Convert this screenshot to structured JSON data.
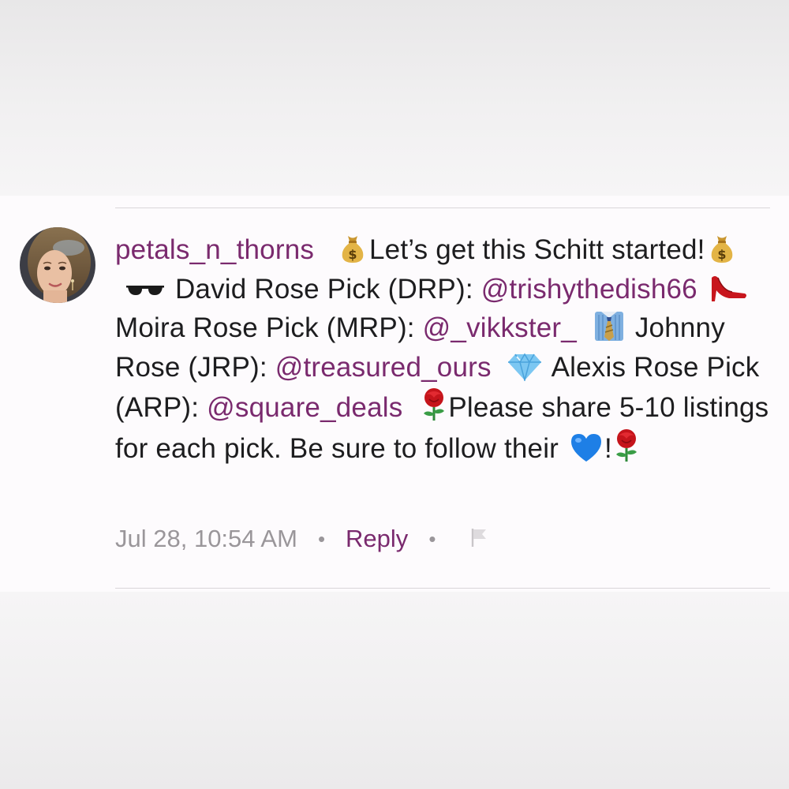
{
  "comment": {
    "username": "petals_n_thorns",
    "text": {
      "t1": "Let’s get this Schitt",
      "t2": "started!",
      "t3": "David Rose Pick (DRP):",
      "m1": "@trishythedish66",
      "t4": "Moira Rose Pick (MRP):",
      "m2": "@_vikkster_",
      "t5": "Johnny Rose (JRP):",
      "m3": "@treasured_ours",
      "t6": "Alexis Rose Pick (ARP):",
      "m4": "@square_deals",
      "t7": "Please share 5-10 listings for each pick. Be sure to follow their",
      "t8": "!"
    },
    "emojis": [
      "money-bag",
      "money-bag",
      "sunglasses",
      "high-heel",
      "necktie-shirt",
      "gem",
      "rose",
      "blue-heart",
      "rose"
    ]
  },
  "meta": {
    "timestamp": "Jul 28, 10:54 AM",
    "separator": "•",
    "reply_label": "Reply"
  },
  "colors": {
    "username": "#7a2a6e",
    "mention": "#7a2a6e",
    "body_text": "#1d1d1f",
    "meta_text": "#9a969a",
    "card_background": "#fdfbfd",
    "page_background": "#f0eff0"
  }
}
